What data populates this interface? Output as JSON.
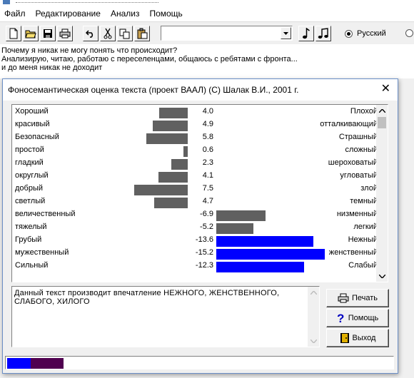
{
  "menu": {
    "items": [
      "Файл",
      "Редактирование",
      "Анализ",
      "Помощь"
    ]
  },
  "toolbar": {
    "buttons": [
      "new-icon",
      "open-icon",
      "save-icon",
      "print-icon",
      "undo-icon",
      "cut-icon",
      "copy-icon",
      "paste-icon"
    ],
    "combo_value": "",
    "music_buttons": [
      "note-icon",
      "double-note-icon"
    ],
    "lang_radio_1": "Русский",
    "lang_radio_1_selected": true
  },
  "text_lines": [
    "Почему я никак не могу понять что происходит?",
    "Анализирую, читаю, работаю с переселенцами, общаюсь с ребятами с фронта...",
    " и до меня никак не доходит"
  ],
  "dialog": {
    "title": "Фоносемантическая оценка текста (проект ВААЛ) (С) Шалак В.И., 2001 г.",
    "close_symbol": "✕",
    "colors": {
      "dark_bar": "#606060",
      "blue_bar": "#0000ff",
      "status_blue": "#0000ff",
      "status_purple": "#500050"
    },
    "scales": [
      {
        "left": "Хороший",
        "value": "4.0",
        "num": 4.0,
        "right": "Плохой",
        "color": "dark"
      },
      {
        "left": "красивый",
        "value": "4.9",
        "num": 4.9,
        "right": "отталкивающий",
        "color": "dark"
      },
      {
        "left": "Безопасный",
        "value": "5.8",
        "num": 5.8,
        "right": "Страшный",
        "color": "dark"
      },
      {
        "left": "простой",
        "value": "0.6",
        "num": 0.6,
        "right": "сложный",
        "color": "dark"
      },
      {
        "left": "гладкий",
        "value": "2.3",
        "num": 2.3,
        "right": "шероховатый",
        "color": "dark"
      },
      {
        "left": "округлый",
        "value": "4.1",
        "num": 4.1,
        "right": "угловатый",
        "color": "dark"
      },
      {
        "left": "добрый",
        "value": "7.5",
        "num": 7.5,
        "right": "злой",
        "color": "dark"
      },
      {
        "left": "светлый",
        "value": "4.7",
        "num": 4.7,
        "right": "темный",
        "color": "dark"
      },
      {
        "left": "величественный",
        "value": "-6.9",
        "num": -6.9,
        "right": "низменный",
        "color": "dark"
      },
      {
        "left": "тяжелый",
        "value": "-5.2",
        "num": -5.2,
        "right": "легкий",
        "color": "dark"
      },
      {
        "left": "Грубый",
        "value": "-13.6",
        "num": -13.6,
        "right": "Нежный",
        "color": "blue"
      },
      {
        "left": "мужественный",
        "value": "-15.2",
        "num": -15.2,
        "right": "женственный",
        "color": "blue"
      },
      {
        "left": "Сильный",
        "value": "-12.3",
        "num": -12.3,
        "right": "Слабый",
        "color": "blue"
      }
    ],
    "result_text": "Данный текст производит впечатление  НЕЖНОГО, ЖЕНСТВЕННОГО, СЛАБОГО, ХИЛОГО",
    "buttons": {
      "print_label": "Печать",
      "help_label": "Помощь",
      "exit_label": "Выход"
    }
  }
}
